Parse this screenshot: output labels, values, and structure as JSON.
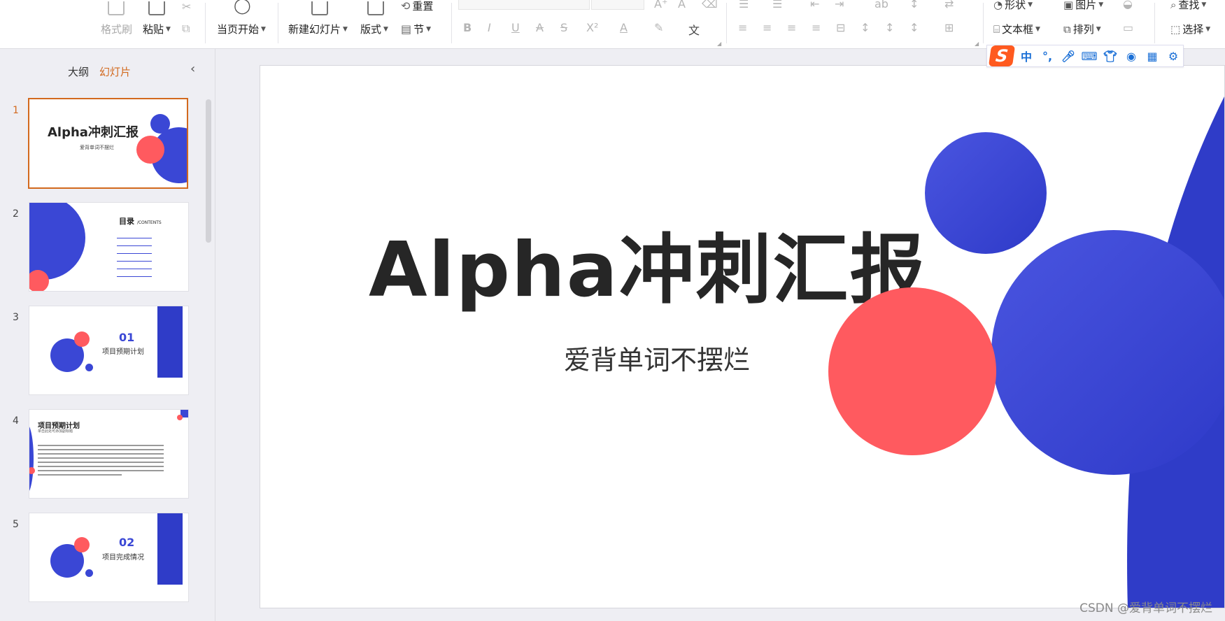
{
  "ribbon": {
    "format_painter": "格式刷",
    "paste": "粘贴",
    "start_from_current": "当页开始",
    "new_slide": "新建幻灯片",
    "layout": "版式",
    "reset": "重置",
    "section": "节",
    "shape": "形状",
    "picture": "图片",
    "find": "查找",
    "textbox": "文本框",
    "arrange": "排列",
    "select": "选择"
  },
  "ime_bar": {
    "mode": "中"
  },
  "panel": {
    "tab_outline": "大纲",
    "tab_slides": "幻灯片",
    "collapse_icon": "chevron-left-icon"
  },
  "thumbnails": [
    {
      "num": "1",
      "title": "Alpha冲刺汇报",
      "subtitle": "爱背单词不摆烂"
    },
    {
      "num": "2",
      "title": "目录",
      "tag": "/CONTENTS"
    },
    {
      "num": "3",
      "index": "01",
      "label": "项目预期计划"
    },
    {
      "num": "4",
      "title": "项目预期计划",
      "subtitle": "单击此处可添加副标题"
    },
    {
      "num": "5",
      "index": "02",
      "label": "项目完成情况"
    }
  ],
  "slide": {
    "title": "Alpha冲刺汇报",
    "subtitle": "爱背单词不摆烂"
  },
  "watermark": "CSDN @爱背单词不摆烂",
  "colors": {
    "accent": "#d2691e",
    "blue": "#3a47d5",
    "coral": "#ff5a5f"
  }
}
